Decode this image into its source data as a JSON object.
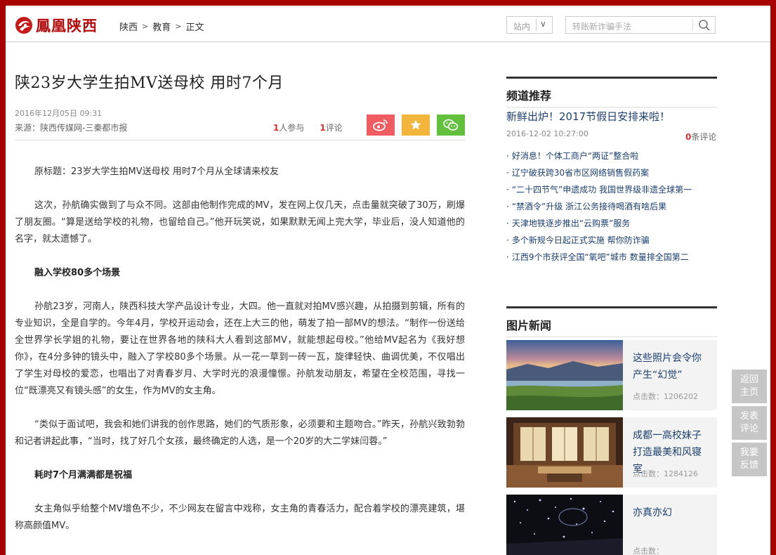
{
  "header": {
    "logo_text": "鳳凰陕西",
    "breadcrumb": [
      "陕西",
      "教育",
      "正文"
    ],
    "site_select": "站内",
    "search_placeholder": "转账新诈骗手法"
  },
  "article": {
    "title": "陕23岁大学生拍MV送母校 用时7个月",
    "date": "2016年12月05日 09:31",
    "source": "来源：陕西传媒网-三秦都市报",
    "participants_num": "1",
    "participants_label": "人参与",
    "comments_num": "1",
    "comments_label": "评论",
    "paragraphs": [
      {
        "type": "p",
        "text": "原标题：23岁大学生拍MV送母校 用时7个月从全球请来校友"
      },
      {
        "type": "p",
        "text": "这次，孙航确实做到了与众不同。这部由他制作完成的MV，发在网上仅几天，点击量就突破了30万，刷爆了朋友圈。“算是送给学校的礼物，也留给自己。”他开玩笑说，如果默默无闻上完大学，毕业后，没人知道他的名字，就太遗憾了。"
      },
      {
        "type": "sub",
        "text": "融入学校80多个场景"
      },
      {
        "type": "p",
        "text": "孙航23岁，河南人，陕西科技大学产品设计专业，大四。他一直就对拍MV感兴趣，从拍摄到剪辑，所有的专业知识，全是自学的。今年4月，学校开运动会，还在上大三的他，萌发了拍一部MV的想法。“制作一份送给全世界学长学姐的礼物，要让在世界各地的陕科大人看到这部MV，就能想起母校。”他给MV起名为《我好想你》，在4分多钟的镜头中，融入了学校80多个场景。从一花一草到一砖一瓦，旋律轻快、曲调优美，不仅唱出了学生对母校的爱恋，也唱出了对青春岁月、大学时光的浪漫憧憬。孙航发动朋友，希望在全校范围，寻找一位“既漂亮又有镜头感”的女生，作为MV的女主角。"
      },
      {
        "type": "p",
        "text": "“类似于面试吧，我会和她们讲我的创作思路，她们的气质形象，必须要和主题吻合。”昨天，孙航兴致勃勃和记者讲起此事，“当时，找了好几个女孩，最终确定的人选，是一个20岁的大二学妹闫蓉。”"
      },
      {
        "type": "sub",
        "text": "耗时7个月满满都是祝福"
      },
      {
        "type": "p",
        "text": "女主角似乎给整个MV增色不少，不少网友在留言中戏称，女主角的青春活力，配合着学校的漂亮建筑，堪称高颜值MV。"
      }
    ]
  },
  "channel": {
    "heading": "频道推荐",
    "headline": "新鲜出炉！2017节假日安排来啦！",
    "headline_date": "2016-12-02 10:27:00",
    "comments_num": "0",
    "comments_label": "条评论",
    "items": [
      "好消息！个体工商户“两证”整合啦",
      "辽宁破获跨30省市区网络销售假药案",
      "“二十四节气”申遗成功 我国世界级非遗全球第一",
      "“禁酒令”升级 浙江公务接待喝酒有啥后果",
      "天津地铁逐步推出“云购票”服务",
      "多个新规今日起正式实施 帮你防诈骗",
      "江西9个市获评全国“氧吧”城市 数量排全国第二"
    ]
  },
  "photo_news": {
    "heading": "图片新闻",
    "click_label": "点击数：",
    "items": [
      {
        "title": "这些照片会令你产生“幻觉”",
        "clicks": "1206202"
      },
      {
        "title": "成都一高校妹子打造最美和风寝室",
        "clicks": "1284126"
      },
      {
        "title": "亦真亦幻",
        "clicks": ""
      }
    ]
  },
  "float_tools": [
    "返回主页",
    "发表评论",
    "我要反馈"
  ],
  "colors": {
    "frame": "#a80000",
    "brand": "#b40d0d",
    "link": "#1a3f6e",
    "weibo": "#ef5d62",
    "fav": "#f3b53b",
    "wechat": "#62c03c"
  }
}
